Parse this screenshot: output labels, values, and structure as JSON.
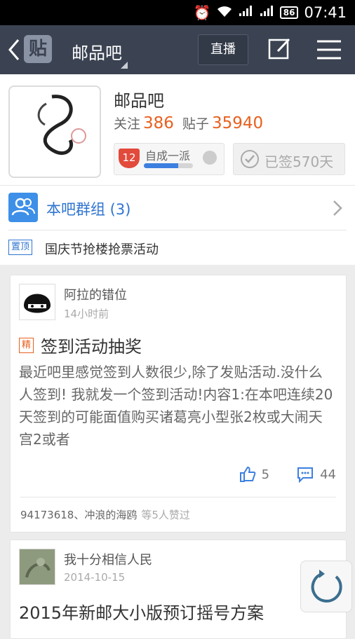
{
  "status_bar": {
    "battery": "86",
    "time": "07:41"
  },
  "nav": {
    "logo_char": "贴",
    "title": "邮品吧",
    "live_label": "直播"
  },
  "forum": {
    "name": "邮品吧",
    "follow_label": "关注",
    "follow_count": "386",
    "posts_label": "贴子",
    "posts_count": "35940",
    "level": {
      "badge": "12",
      "name": "自成一派",
      "progress": 0.7
    },
    "signed_label": "已签570天",
    "logo_text": "邮品吧"
  },
  "group": {
    "label": "本吧群组 (3)"
  },
  "pinned": {
    "tag": "置顶",
    "text": "国庆节抢楼抢票活动"
  },
  "posts": [
    {
      "author": "阿拉的错位",
      "time": "14小时前",
      "tag": "精",
      "title": "签到活动抽奖",
      "body": "最近吧里感觉签到人数很少,除了发贴活动.没什么人签到! 我就发一个签到活动!内容1:在本吧连续20天签到的可能面值购买诸葛亮小型张2枚或大闹天宫2或者",
      "likes": "5",
      "comments": "44",
      "liked_by": "94173618、冲浪的海鸥",
      "liked_more": "等5人赞过"
    },
    {
      "author": "我十分相信人民",
      "time": "2014-10-15",
      "title": "2015年新邮大小版预订摇号方案"
    }
  ],
  "colors": {
    "nav_bg": "#3b4352",
    "accent_orange": "#e8601f",
    "accent_blue": "#2f74d1"
  }
}
